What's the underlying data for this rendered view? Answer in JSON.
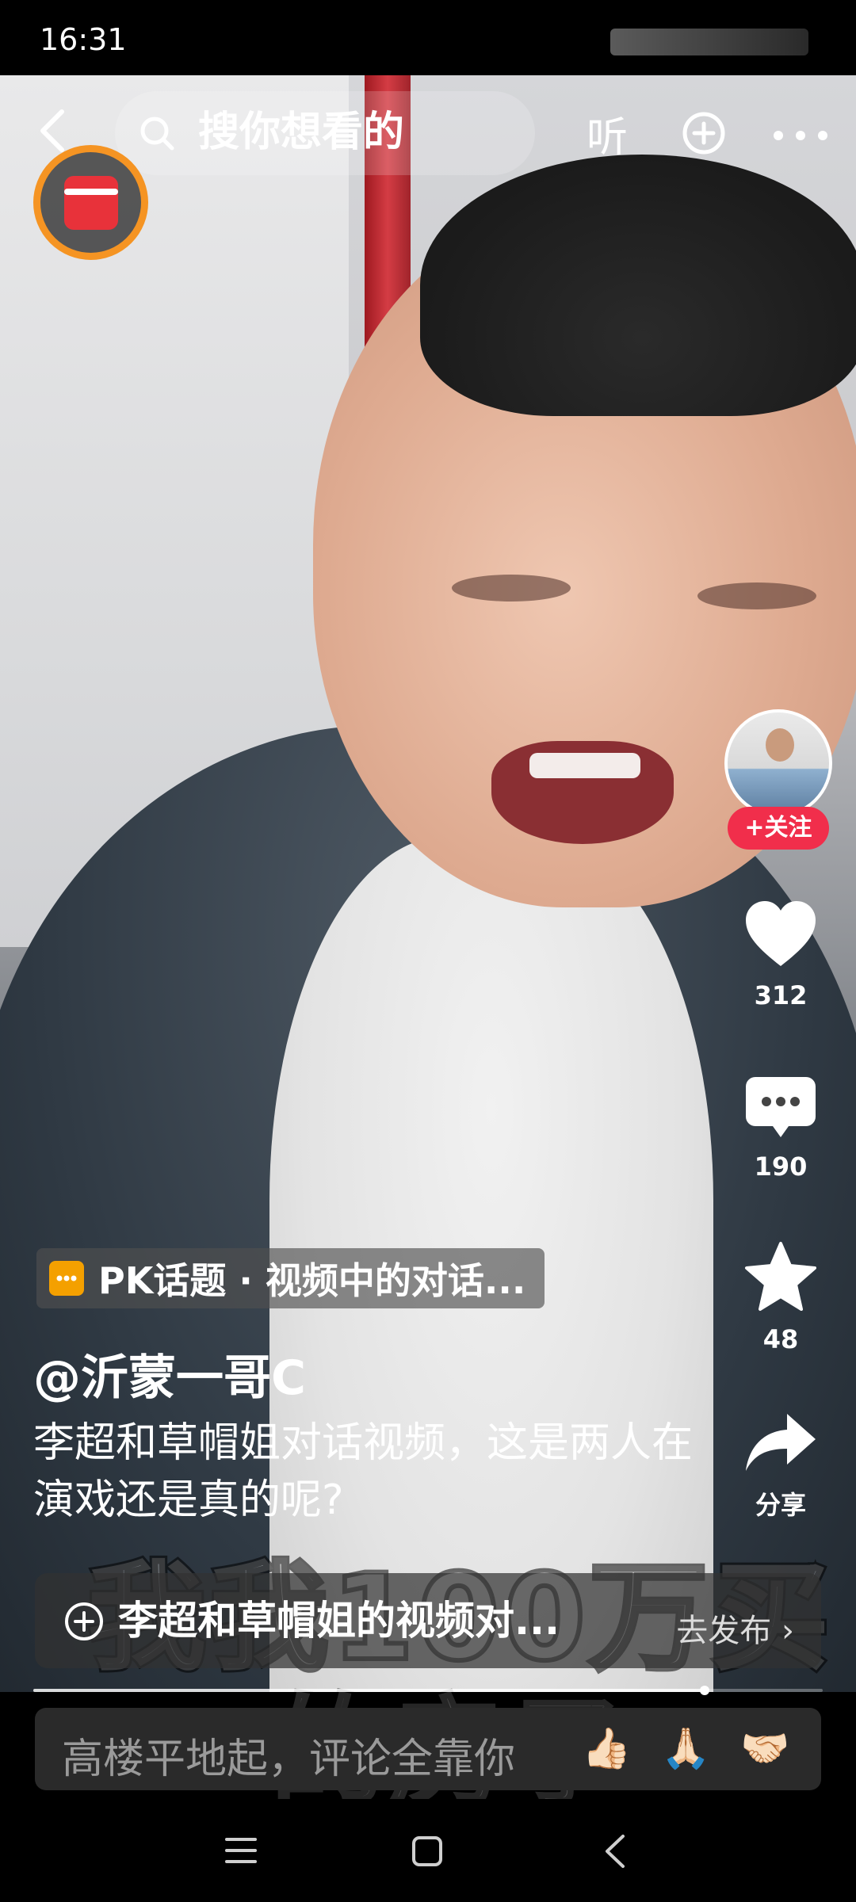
{
  "status_bar": {
    "time": "16:31"
  },
  "top_bar": {
    "search_placeholder": "搜你想看的",
    "listen_label": "听"
  },
  "side_actions": {
    "follow_label": "+关注",
    "like_count": "312",
    "comment_count": "190",
    "favorite_count": "48",
    "share_label": "分享"
  },
  "video_info": {
    "topic_tag": "PK话题 · 视频中的对话...",
    "author": "@沂蒙一哥C",
    "caption": "李超和草帽姐对话视频，这是两人在演戏还是真的呢?",
    "overlay_subtitle_line1": "我我100万买",
    "overlay_subtitle_line2": "的房子"
  },
  "publish_bar": {
    "text": "李超和草帽姐的视频对...",
    "button_label": "去发布 ›"
  },
  "progress": {
    "fraction": 0.85
  },
  "comment_bar": {
    "placeholder": "高楼平地起，评论全靠你",
    "emojis": [
      "👍🏻",
      "🙏🏻",
      "🤝🏻"
    ]
  },
  "colors": {
    "follow_red": "#f12e4b",
    "redpack_ring": "#f59423",
    "topic_icon": "#f4a000"
  }
}
